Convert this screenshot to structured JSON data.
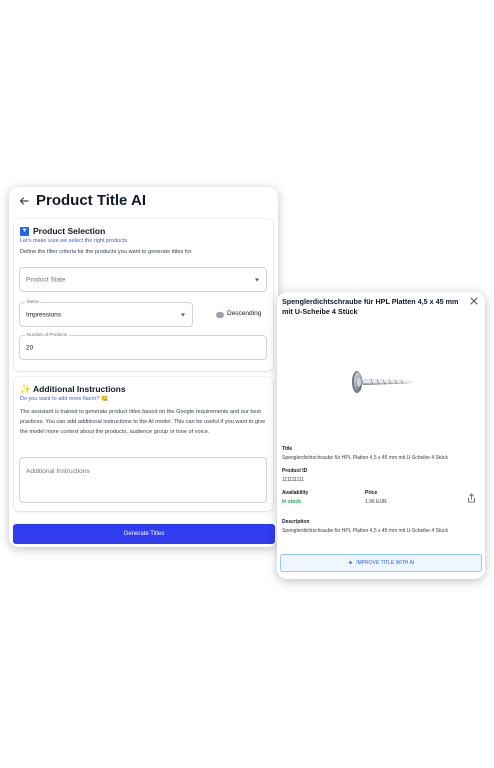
{
  "app": {
    "title": "Product Title AI"
  },
  "product_selection": {
    "title": "Product Selection",
    "subtitle": "Let's make sure we select the right products.",
    "description": "Define the filter criteria for the products you want to generate titles for.",
    "product_state_placeholder": "Product State",
    "metric_label": "Metric",
    "metric_value": "Impressions",
    "sort_label": "Descending",
    "sort_descending": false,
    "number_label": "Number of Products",
    "number_value": "20"
  },
  "additional_instructions": {
    "title": "Additional Instructions",
    "subtitle": "Do you want to add more flavor? 😋",
    "description": "The assistant is trained to generate product titles based on the Google requirements and our best practices. You can add additional instructions to the AI model. This can be useful if you want to give the model more context about the products, audience group or tone of voice.",
    "placeholder": "Additional Instructions"
  },
  "generate_button": "Generate Titles",
  "product_card": {
    "heading": "Spenglerdichtschraube für HPL Platten 4,5 x 45 mm mit U-Scheibe 4 Stück",
    "title_label": "Title",
    "title_value": "Spenglerdichtschraube für HPL Platten 4,5 x 45 mm mit U-Scheibe 4 Stück",
    "id_label": "Product ID",
    "id_value": "111111111",
    "availability_label": "Availability",
    "availability_value": "In stock",
    "price_label": "Price",
    "price_value": "1.96 EUR",
    "description_label": "Description",
    "description_value": "Spenglerdichtschraube für HPL Platten 4,5 x 45 mm mit U-Scheibe 4 Stück",
    "improve_button": "IMPROVE TITLE WITH AI"
  },
  "icons": {
    "back": "arrow-left-icon",
    "selection": "filter-icon",
    "instructions": "sparkles-icon",
    "close": "close-icon",
    "share": "share-icon",
    "improve": "sparkles-icon"
  },
  "colors": {
    "primary": "#2f3cf0",
    "link": "#3b5bdb",
    "in_stock": "#16a34a",
    "improve_bg": "#eff6ff"
  }
}
